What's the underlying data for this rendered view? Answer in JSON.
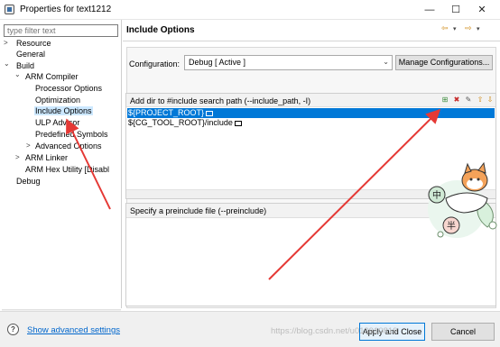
{
  "window": {
    "title": "Properties for text1212",
    "controls": {
      "minimize": "—",
      "maximize": "☐",
      "close": "✕"
    }
  },
  "sidebar": {
    "filter_placeholder": "type filter text",
    "items": [
      {
        "label": "Resource",
        "twisty": ">"
      },
      {
        "label": "General"
      },
      {
        "label": "Build",
        "twisty": "⌄"
      },
      {
        "label": "ARM Compiler",
        "twisty": "⌄"
      },
      {
        "label": "Processor Options"
      },
      {
        "label": "Optimization"
      },
      {
        "label": "Include Options",
        "selected": true
      },
      {
        "label": "ULP Advisor"
      },
      {
        "label": "Predefined Symbols"
      },
      {
        "label": "Advanced Options",
        "twisty": ">"
      },
      {
        "label": "ARM Linker",
        "twisty": ">"
      },
      {
        "label": "ARM Hex Utility  [Disabl"
      },
      {
        "label": "Debug"
      }
    ],
    "scroll": {
      "left": "◂",
      "right": "▸"
    }
  },
  "main": {
    "title": "Include Options",
    "nav_icons": [
      "back-icon",
      "dropdown-icon",
      "forward-icon",
      "dropdown-icon"
    ],
    "nav_glyphs": {
      "back": "⇦",
      "back_menu": "▾",
      "forward": "⇨",
      "forward_menu": "▾"
    },
    "configuration": {
      "label": "Configuration:",
      "selected": "Debug  [ Active ]",
      "caret": "⌄",
      "manage_label": "Manage Configurations..."
    },
    "include_path": {
      "header": "Add dir to #include search path (--include_path, -I)",
      "rows": [
        "${PROJECT_ROOT}",
        "${CG_TOOL_ROOT}/include"
      ],
      "toolbar_icons": [
        "add-icon",
        "delete-icon",
        "edit-icon",
        "move-up-icon",
        "move-down-icon"
      ],
      "toolbar_glyphs": {
        "add": "⊞",
        "delete": "✖",
        "edit": "✎",
        "up": "⇧",
        "down": "⇩"
      },
      "colors": {
        "add": "#3a8a3a",
        "delete": "#c62828",
        "edit": "#555555",
        "move": "#d08a17"
      }
    },
    "preinclude": {
      "header": "Specify a preinclude file (--preinclude)"
    }
  },
  "footer": {
    "help_glyph": "?",
    "advanced_link": "Show advanced settings",
    "apply_close": "Apply and Close",
    "cancel": "Cancel",
    "watermark": "https://blog.csdn.net/u013910819"
  },
  "sticker": {
    "text_top": "中",
    "text_bottom": "半"
  },
  "colors": {
    "selection_row": "#0078d7",
    "tree_selection": "#cce8ff",
    "link": "#0066cc",
    "annotation_arrow": "#e53935"
  }
}
